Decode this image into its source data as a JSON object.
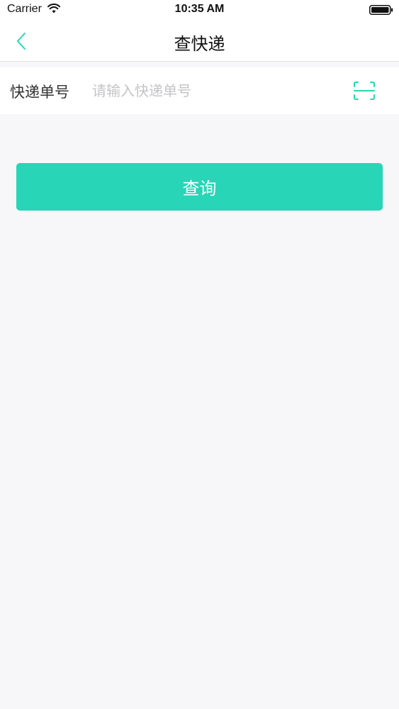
{
  "status_bar": {
    "carrier": "Carrier",
    "time": "10:35 AM",
    "wifi_icon": "wifi-icon",
    "battery_icon": "battery-icon"
  },
  "nav": {
    "title": "查快递",
    "back_icon": "chevron-left-icon"
  },
  "form": {
    "label": "快递单号",
    "input_value": "",
    "input_placeholder": "请输入快递单号",
    "scan_icon": "scan-icon"
  },
  "actions": {
    "query_label": "查询"
  },
  "colors": {
    "accent": "#28d5b6",
    "background": "#f7f6f8",
    "surface": "#ffffff",
    "placeholder": "#c4c4c8",
    "text": "#333333"
  }
}
